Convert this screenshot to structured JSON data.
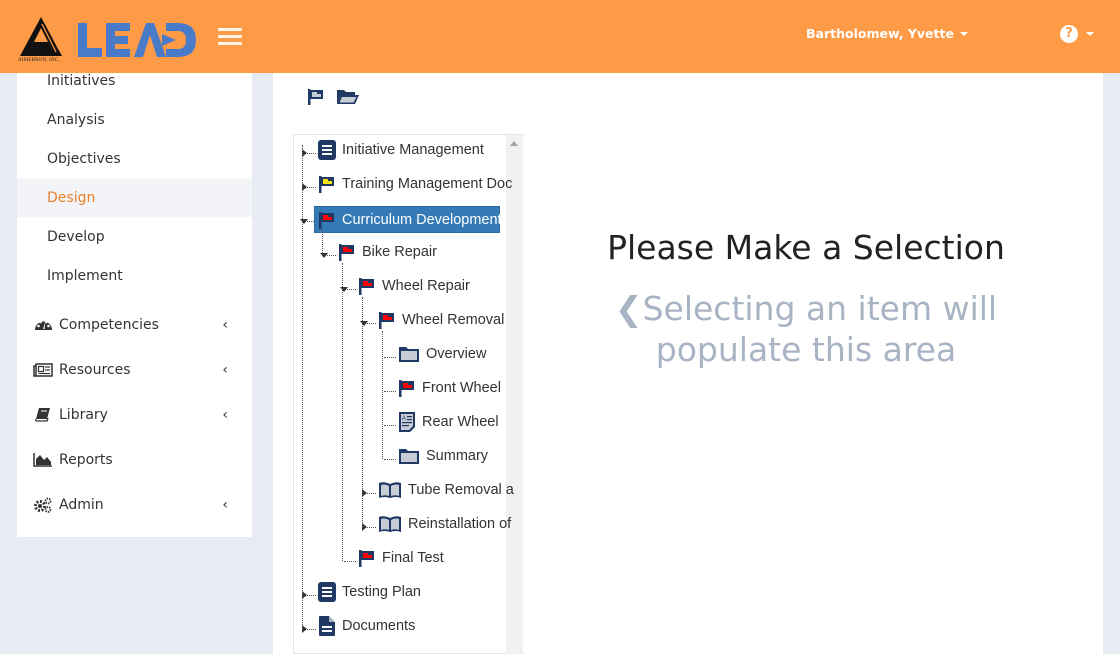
{
  "header": {
    "logo_text": "LEAD",
    "logo_caption": "AIMERRON, INC.",
    "user_name": "Bartholomew, Yvette",
    "help_glyph": "?",
    "brand_color": "#ff9a47",
    "logo_color": "#4a7bc8"
  },
  "sidebar": {
    "sub_items": [
      {
        "label": "Initiatives",
        "active": false
      },
      {
        "label": "Analysis",
        "active": false
      },
      {
        "label": "Objectives",
        "active": false
      },
      {
        "label": "Design",
        "active": true
      },
      {
        "label": "Develop",
        "active": false
      },
      {
        "label": "Implement",
        "active": false
      }
    ],
    "main_items": [
      {
        "label": "Competencies",
        "icon": "dashboard-icon",
        "has_submenu": true
      },
      {
        "label": "Resources",
        "icon": "newspaper-icon",
        "has_submenu": true
      },
      {
        "label": "Library",
        "icon": "book-icon",
        "has_submenu": true
      },
      {
        "label": "Reports",
        "icon": "area-chart-icon",
        "has_submenu": false
      },
      {
        "label": "Admin",
        "icon": "cogs-icon",
        "has_submenu": true
      }
    ],
    "chevron": "‹",
    "active_color": "#e8802b"
  },
  "toolbar": {
    "flag_icon": "flag-icon",
    "folder_icon": "folder-open-icon"
  },
  "tree": {
    "nodes": [
      {
        "label": "Initiative Management",
        "icon": "list-doc-icon",
        "depth": 0,
        "state": "collapsed"
      },
      {
        "label": "Training Management Doc",
        "icon": "flag-yellow-icon",
        "depth": 0,
        "state": "collapsed"
      },
      {
        "label": "Curriculum Development",
        "icon": "flag-red-icon",
        "depth": 0,
        "state": "expanded",
        "selected": true
      },
      {
        "label": "Bike Repair",
        "icon": "flag-red-icon",
        "depth": 1,
        "state": "expanded"
      },
      {
        "label": "Wheel Repair",
        "icon": "flag-red-icon",
        "depth": 2,
        "state": "expanded"
      },
      {
        "label": "Wheel Removal",
        "icon": "flag-red-icon",
        "depth": 3,
        "state": "expanded"
      },
      {
        "label": "Overview",
        "icon": "folder-icon",
        "depth": 4,
        "state": "leaf"
      },
      {
        "label": "Front Wheel",
        "icon": "flag-red-icon",
        "depth": 4,
        "state": "leaf"
      },
      {
        "label": "Rear Wheel",
        "icon": "document-text-icon",
        "depth": 4,
        "state": "leaf"
      },
      {
        "label": "Summary",
        "icon": "folder-icon",
        "depth": 4,
        "state": "leaf"
      },
      {
        "label": "Tube Removal a",
        "icon": "book-open-icon",
        "depth": 3,
        "state": "collapsed"
      },
      {
        "label": "Reinstallation of",
        "icon": "book-open-icon",
        "depth": 3,
        "state": "collapsed"
      },
      {
        "label": "Final Test",
        "icon": "flag-red-icon",
        "depth": 2,
        "state": "leaf"
      },
      {
        "label": "Testing Plan",
        "icon": "list-doc-icon",
        "depth": 0,
        "state": "collapsed"
      },
      {
        "label": "Documents",
        "icon": "file-icon",
        "depth": 0,
        "state": "collapsed"
      }
    ],
    "selected_color": "#337ab7"
  },
  "placeholder": {
    "title": "Please Make a Selection",
    "chevron": "❮",
    "line1": "Selecting an item will",
    "line2": "populate this area"
  }
}
